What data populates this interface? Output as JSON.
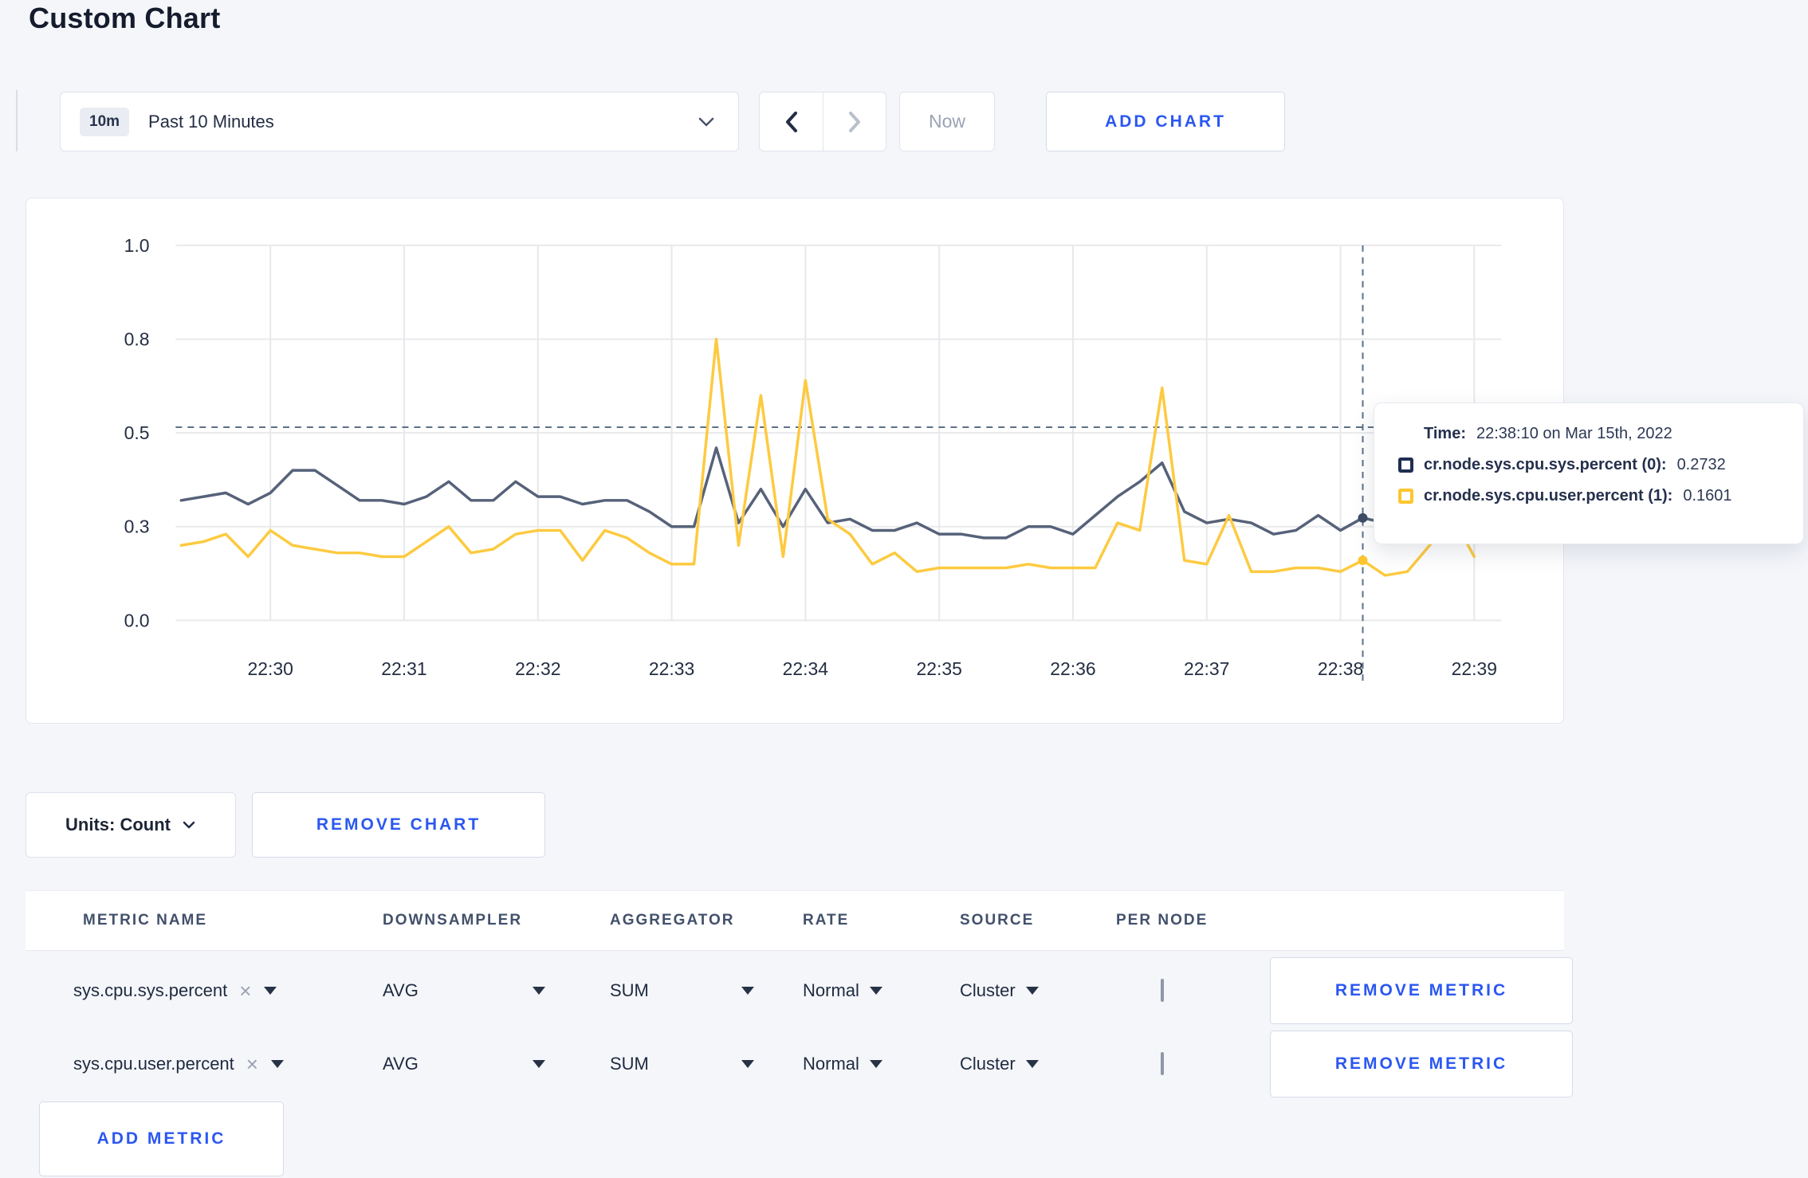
{
  "page": {
    "title": "Custom Chart"
  },
  "toolbar": {
    "time_selector": {
      "badge": "10m",
      "label": "Past 10 Minutes"
    },
    "now_label": "Now",
    "add_chart_label": "ADD CHART"
  },
  "chart_data": {
    "type": "line",
    "title": "",
    "xlabel": "",
    "ylabel": "",
    "ylim": [
      0,
      1
    ],
    "grid": true,
    "legend_position": "none",
    "y_ticks": [
      {
        "v": 0,
        "label": "0.0"
      },
      {
        "v": 0.25,
        "label": "0.3"
      },
      {
        "v": 0.5,
        "label": "0.5"
      },
      {
        "v": 0.75,
        "label": "0.8"
      },
      {
        "v": 1.0,
        "label": "1.0"
      }
    ],
    "x": [
      "22:29:20",
      "22:29:30",
      "22:29:40",
      "22:29:50",
      "22:30:00",
      "22:30:10",
      "22:30:20",
      "22:30:30",
      "22:30:40",
      "22:30:50",
      "22:31:00",
      "22:31:10",
      "22:31:20",
      "22:31:30",
      "22:31:40",
      "22:31:50",
      "22:32:00",
      "22:32:10",
      "22:32:20",
      "22:32:30",
      "22:32:40",
      "22:32:50",
      "22:33:00",
      "22:33:10",
      "22:33:20",
      "22:33:30",
      "22:33:40",
      "22:33:50",
      "22:34:00",
      "22:34:10",
      "22:34:20",
      "22:34:30",
      "22:34:40",
      "22:34:50",
      "22:35:00",
      "22:35:10",
      "22:35:20",
      "22:35:30",
      "22:35:40",
      "22:35:50",
      "22:36:00",
      "22:36:10",
      "22:36:20",
      "22:36:30",
      "22:36:40",
      "22:36:50",
      "22:37:00",
      "22:37:10",
      "22:37:20",
      "22:37:30",
      "22:37:40",
      "22:37:50",
      "22:38:00",
      "22:38:10",
      "22:38:20",
      "22:38:30",
      "22:38:40",
      "22:38:50",
      "22:39:00"
    ],
    "x_tick_labels": [
      "22:30",
      "22:31",
      "22:32",
      "22:33",
      "22:34",
      "22:35",
      "22:36",
      "22:37",
      "22:38",
      "22:39"
    ],
    "x_tick_indices": [
      4,
      10,
      16,
      22,
      28,
      34,
      40,
      46,
      52,
      58
    ],
    "series": [
      {
        "name": "cr.node.sys.cpu.sys.percent",
        "color": "#566279",
        "values": [
          0.32,
          0.33,
          0.34,
          0.31,
          0.34,
          0.4,
          0.4,
          0.36,
          0.32,
          0.32,
          0.31,
          0.33,
          0.37,
          0.32,
          0.32,
          0.37,
          0.33,
          0.33,
          0.31,
          0.32,
          0.32,
          0.29,
          0.25,
          0.25,
          0.46,
          0.26,
          0.35,
          0.25,
          0.35,
          0.26,
          0.27,
          0.24,
          0.24,
          0.26,
          0.23,
          0.23,
          0.22,
          0.22,
          0.25,
          0.25,
          0.23,
          0.28,
          0.33,
          0.37,
          0.42,
          0.29,
          0.26,
          0.27,
          0.26,
          0.23,
          0.24,
          0.28,
          0.24,
          0.2732,
          0.26,
          0.3,
          0.3,
          0.31,
          0.3
        ]
      },
      {
        "name": "cr.node.sys.cpu.user.percent",
        "color": "#fdca40",
        "values": [
          0.2,
          0.21,
          0.23,
          0.17,
          0.24,
          0.2,
          0.19,
          0.18,
          0.18,
          0.17,
          0.17,
          0.21,
          0.25,
          0.18,
          0.19,
          0.23,
          0.24,
          0.24,
          0.16,
          0.24,
          0.22,
          0.18,
          0.15,
          0.15,
          0.75,
          0.2,
          0.6,
          0.17,
          0.64,
          0.27,
          0.23,
          0.15,
          0.18,
          0.13,
          0.14,
          0.14,
          0.14,
          0.14,
          0.15,
          0.14,
          0.14,
          0.14,
          0.26,
          0.24,
          0.62,
          0.16,
          0.15,
          0.28,
          0.13,
          0.13,
          0.14,
          0.14,
          0.13,
          0.1601,
          0.12,
          0.13,
          0.2,
          0.28,
          0.17
        ]
      }
    ],
    "crosshair": {
      "index": 53,
      "h_value": 0.515
    }
  },
  "tooltip": {
    "time_label": "Time:",
    "time_value": "22:38:10 on Mar 15th, 2022",
    "series": [
      {
        "label": "cr.node.sys.cpu.sys.percent (0):",
        "value": "0.2732"
      },
      {
        "label": "cr.node.sys.cpu.user.percent (1):",
        "value": "0.1601"
      }
    ]
  },
  "units": {
    "label": "Units: Count"
  },
  "remove_chart_label": "REMOVE CHART",
  "table": {
    "headers": [
      "METRIC NAME",
      "DOWNSAMPLER",
      "AGGREGATOR",
      "RATE",
      "SOURCE",
      "PER NODE"
    ],
    "rows": [
      {
        "metric": "sys.cpu.sys.percent",
        "downsampler": "AVG",
        "aggregator": "SUM",
        "rate": "Normal",
        "source": "Cluster",
        "per_node_checked": false,
        "remove_label": "REMOVE METRIC"
      },
      {
        "metric": "sys.cpu.user.percent",
        "downsampler": "AVG",
        "aggregator": "SUM",
        "rate": "Normal",
        "source": "Cluster",
        "per_node_checked": false,
        "remove_label": "REMOVE METRIC"
      }
    ]
  },
  "add_metric_label": "ADD METRIC",
  "colors": {
    "accent_blue": "#2b57f1",
    "series_sys": "#566279",
    "series_user": "#fdca40",
    "swatch_sys": "#202e52",
    "swatch_user": "#fdc62e",
    "page_background": "#f4f6fa",
    "gridline": "#e9eaec",
    "crosshair": "#5c7086",
    "disabled_text": "#9aa3b3"
  }
}
